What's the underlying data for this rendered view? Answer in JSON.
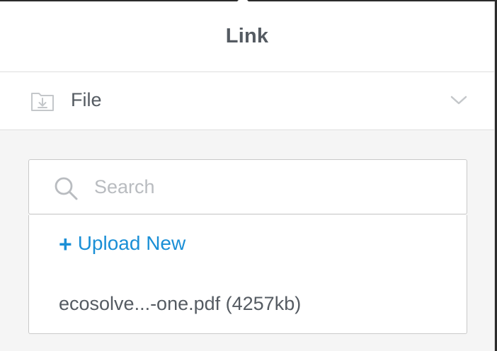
{
  "header": {
    "title": "Link"
  },
  "link_type": {
    "label": "File",
    "icon": "folder-download-icon",
    "dropdown_icon": "chevron-down-icon"
  },
  "search": {
    "placeholder": "Search",
    "value": "",
    "icon": "search-icon"
  },
  "results": {
    "upload_plus": "+",
    "upload_label": "Upload New",
    "files": [
      {
        "label": "ecosolve...-one.pdf (4257kb)"
      }
    ]
  },
  "colors": {
    "accent": "#1a8fd6",
    "text": "#555b62",
    "placeholder": "#b9bcc0",
    "background": "#f5f5f5"
  }
}
